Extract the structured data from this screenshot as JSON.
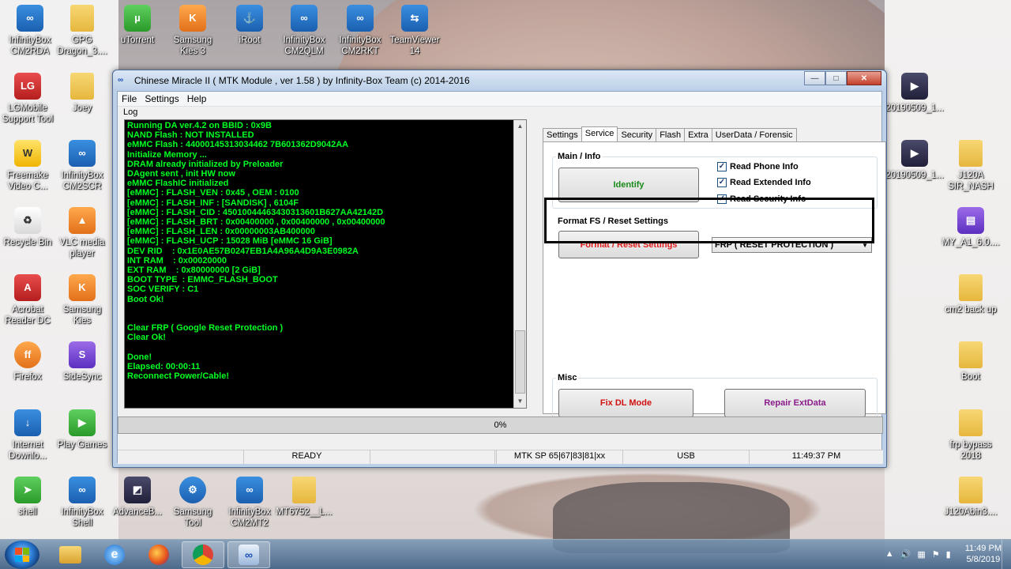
{
  "desktop": {
    "icons": [
      {
        "label": "InfinityBox\nCM2RDA",
        "icon": "infinitybox-rda-icon"
      },
      {
        "label": "GPG\nDragon_3....",
        "icon": "folder-icon"
      },
      {
        "label": "uTorrent",
        "icon": "utorrent-icon"
      },
      {
        "label": "Samsung\nKies 3",
        "icon": "samsung-kies-icon"
      },
      {
        "label": "iRoot",
        "icon": "iroot-icon"
      },
      {
        "label": "InfinityBox\nCM2QLM",
        "icon": "infinitybox-qlm-icon"
      },
      {
        "label": "InfinityBox\nCM2RKT",
        "icon": "infinitybox-rkt-icon"
      },
      {
        "label": "TeamViewer\n14",
        "icon": "teamviewer-icon"
      },
      {
        "label": "LGMobile\nSupport Tool",
        "icon": "lg-mobile-icon"
      },
      {
        "label": "Joey",
        "icon": "folder-icon"
      },
      {
        "label": "Freemake\nVideo C...",
        "icon": "freemake-icon"
      },
      {
        "label": "InfinityBox\nCM2SCR",
        "icon": "infinitybox-scr-icon"
      },
      {
        "label": "Recycle Bin",
        "icon": "recycle-bin-icon"
      },
      {
        "label": "VLC media\nplayer",
        "icon": "vlc-icon"
      },
      {
        "label": "Acrobat\nReader DC",
        "icon": "acrobat-icon"
      },
      {
        "label": "Samsung\nKies",
        "icon": "samsung-kies-icon"
      },
      {
        "label": "Firefox",
        "icon": "firefox-icon"
      },
      {
        "label": "SideSync",
        "icon": "sidesync-icon"
      },
      {
        "label": "Internet\nDownlo...",
        "icon": "idm-icon"
      },
      {
        "label": "Play Games",
        "icon": "play-games-icon"
      },
      {
        "label": "shell",
        "icon": "shell-icon"
      },
      {
        "label": "InfinityBox\nShell",
        "icon": "infinitybox-shell-icon"
      },
      {
        "label": "AdvanceB...",
        "icon": "advance-icon"
      },
      {
        "label": "Samsung\nTool",
        "icon": "samsung-tool-icon"
      },
      {
        "label": "InfinityBox\nCM2MT2",
        "icon": "infinitybox-mt2-icon"
      },
      {
        "label": "MT6752__L...",
        "icon": "folder-icon"
      },
      {
        "label": "20190509_1...",
        "icon": "video-file-icon"
      },
      {
        "label": "20190509_1...",
        "icon": "video-file-icon"
      },
      {
        "label": "J120A\nSIR_NASH",
        "icon": "folder-icon"
      },
      {
        "label": "MY_A1_6.0....",
        "icon": "winrar-icon"
      },
      {
        "label": "cm2 back up",
        "icon": "folder-icon"
      },
      {
        "label": "Boot",
        "icon": "folder-icon"
      },
      {
        "label": "frp bypass\n2018",
        "icon": "folder-icon"
      },
      {
        "label": "J120Abin3....",
        "icon": "folder-icon"
      }
    ]
  },
  "window": {
    "title": "Chinese Miracle II ( MTK Module , ver 1.58 ) by Infinity-Box Team (c) 2014-2016",
    "menu": [
      "File",
      "Settings",
      "Help"
    ],
    "log_label": "Log",
    "log_lines": [
      "Running DA ver.4.2 on BBID : 0x9B",
      "NAND Flash : NOT INSTALLED",
      "eMMC Flash : 44000145313034462 7B601362D9042AA",
      "Initialize Memory ...",
      "DRAM already initialized by Preloader",
      "DAgent sent , init HW now",
      "eMMC FlashIC initialized",
      "[eMMC] : FLASH_VEN : 0x45 , OEM : 0100",
      "[eMMC] : FLASH_INF : [SANDISK] , 6104F",
      "[eMMC] : FLASH_CID : 45010044463430313601B627AA42142D",
      "[eMMC] : FLASH_BRT : 0x00400000 , 0x00400000 , 0x00400000",
      "[eMMC] : FLASH_LEN : 0x00000003AB400000",
      "[eMMC] : FLASH_UCP : 15028 MiB [eMMC 16 GiB]",
      "DEV RID    : 0x1E0AE57B0247EB1A4A96A4D9A3E0982A",
      "INT RAM    : 0x00020000",
      "EXT RAM    : 0x80000000 [2 GiB]",
      "BOOT TYPE  : EMMC_FLASH_BOOT",
      "SOC VERIFY : C1",
      "Boot Ok!",
      "",
      "",
      "Clear FRP ( Google Reset Protection )",
      "Clear Ok!",
      "",
      "Done!",
      "Elapsed: 00:00:11",
      "Reconnect Power/Cable!"
    ],
    "tabs": [
      "Settings",
      "Service",
      "Security",
      "Flash",
      "Extra",
      "UserData / Forensic"
    ],
    "active_tab": "Service",
    "main_info": {
      "title": "Main / Info",
      "identify": "Identify",
      "checks": [
        {
          "label": "Read Phone Info",
          "checked": true
        },
        {
          "label": "Read Extended Info",
          "checked": true
        },
        {
          "label": "Read Security Info",
          "checked": true
        }
      ]
    },
    "format": {
      "title": "Format FS / Reset Settings",
      "button": "Format / Reset Settings",
      "select_value": "FRP ( RESET PROTECTION )"
    },
    "misc": {
      "title": "Misc",
      "fix_dl": "Fix DL Mode",
      "repair": "Repair ExtData"
    },
    "progress_text": "0%",
    "progress_value": 0,
    "status": {
      "state": "READY",
      "chip": "MTK SP 65|67|83|81|xx",
      "port": "USB",
      "time": "11:49:37 PM"
    },
    "colors": {
      "log_text": "#00ff24",
      "identify": "#1a8a1a",
      "format": "#e01b1b",
      "fix_dl": "#d01010",
      "repair": "#8a1a8a"
    }
  },
  "taskbar": {
    "clock_time": "11:49 PM",
    "clock_date": "5/8/2019",
    "tray_symbol": "▲"
  }
}
